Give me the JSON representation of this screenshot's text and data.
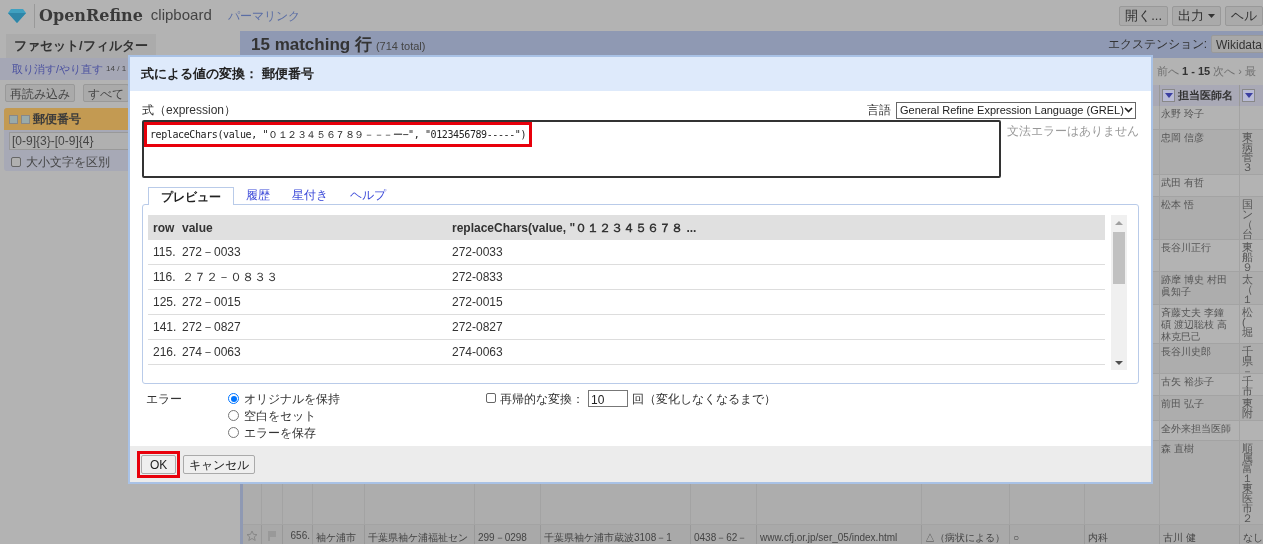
{
  "header": {
    "logo_text": "OpenRefine",
    "project": "clipboard",
    "permalink": "パーマリンク",
    "buttons": [
      {
        "label": "開く...",
        "dropdown": false
      },
      {
        "label": "出力",
        "dropdown": true
      },
      {
        "label": "ヘル",
        "dropdown": false
      }
    ]
  },
  "left_panel": {
    "tab": "ファセット/フィルター",
    "undo_link": "取り消す/やり直す",
    "undo_count": "14 / 1",
    "buttons": [
      "再読み込み",
      "すべて"
    ],
    "facet": {
      "title": "郵便番号",
      "pattern": "[0-9]{3}-[0-9]{4}",
      "case_option": {
        "label": "大小文字を区別",
        "checked": false
      }
    }
  },
  "summary": {
    "count": "15 matching 行",
    "total": "(714 total)",
    "extension_label": "エクステンション:",
    "extension_menu": "Wikidata"
  },
  "pager": [
    "前へ",
    "1 - 15",
    "次へ ›",
    "最"
  ],
  "table": {
    "columns": [
      "担当医師名"
    ],
    "rows": [
      {
        "doctor": "永野 玲子"
      },
      {
        "doctor": "忠岡 信彦",
        "column_3": "東病菅３"
      },
      {
        "doctor": "武田 有哲"
      },
      {
        "doctor": "松本 悟",
        "column_3": "国ン（台"
      },
      {
        "doctor": "長谷川正行",
        "column_3": "東船９"
      },
      {
        "doctor": "跡摩 博史 村田眞知子",
        "column_3": "太（１"
      },
      {
        "doctor": "斉藤丈夫 李鐘碩 渡辺聡枝 高林克巳己",
        "column_3": "松(堀"
      },
      {
        "doctor": "長谷川史郎",
        "column_3": "千県－"
      },
      {
        "doctor": "古矢 裕歩子",
        "column_3": "千市"
      },
      {
        "doctor": "前田 弘子",
        "column_3": "東附"
      },
      {
        "doctor": "全外来担当医師"
      },
      {
        "doctor": "森 直樹",
        "column_3": "順属富１東医市２"
      }
    ],
    "full_rows": [
      {
        "index": "656.",
        "cells": [
          "袖ケ浦市",
          "千葉県袖ケ浦福祉セン",
          "299－0298",
          "千葉県袖ケ浦市蔵波3108－1",
          "0438－62－",
          "www.cfj.or.jp/ser_05/index.html",
          "△（病状による）",
          "○",
          "内科",
          "古川 健",
          "なし"
        ]
      }
    ]
  },
  "dialog": {
    "title": "式による値の変換： 郵便番号",
    "expression_label": "式（expression）",
    "language_label": "言語",
    "language": "General Refine Expression Language (GREL)",
    "expression": "replaceChars(value, \"０１２３４５６７８９－－－ー−\", \"0123456789-----\")",
    "expression_highlighted": true,
    "status": "文法エラーはありません",
    "tabs": [
      {
        "label": "プレビュー",
        "selected": true
      },
      {
        "label": "履歴",
        "selected": false
      },
      {
        "label": "星付き",
        "selected": false
      },
      {
        "label": "ヘルプ",
        "selected": false
      }
    ],
    "preview": {
      "columns": [
        "row",
        "value",
        "replaceChars(value, \"０１２３４５６７８ ..."
      ],
      "rows": [
        [
          "115.",
          "272－0033",
          "272-0033"
        ],
        [
          "116.",
          "２７２－０８３３",
          "272-0833"
        ],
        [
          "125.",
          "272－0015",
          "272-0015"
        ],
        [
          "141.",
          "272－0827",
          "272-0827"
        ],
        [
          "216.",
          "274－0063",
          "274-0063"
        ]
      ]
    },
    "error_label": "エラー",
    "error_options": [
      {
        "label": "オリジナルを保持",
        "selected": true
      },
      {
        "label": "空白をセット",
        "selected": false
      },
      {
        "label": "エラーを保存",
        "selected": false
      }
    ],
    "repeat": {
      "label": "再帰的な変換：",
      "checked": false,
      "count": "10",
      "suffix": "回（変化しなくなるまで）"
    },
    "buttons": [
      {
        "label": "OK",
        "highlighted": true
      },
      {
        "label": "キャンセル",
        "highlighted": false
      }
    ]
  }
}
